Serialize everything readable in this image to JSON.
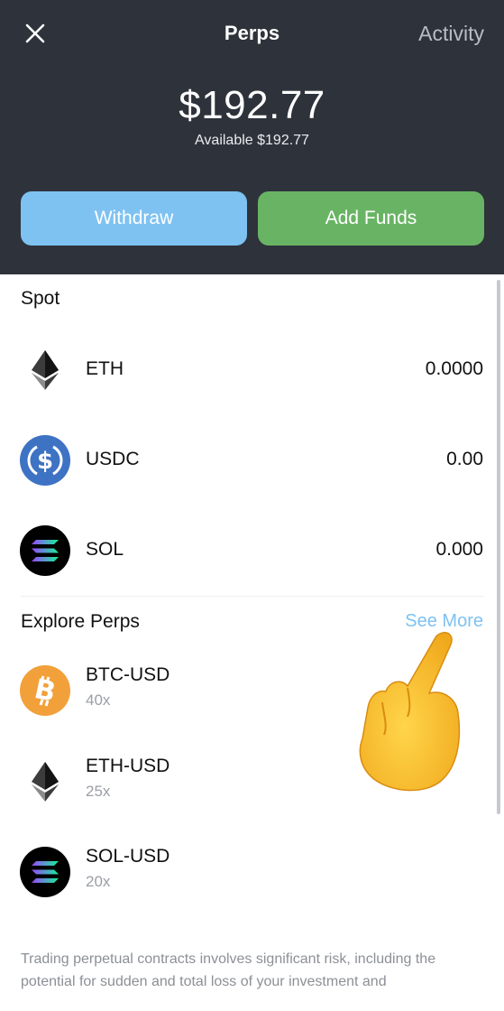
{
  "header": {
    "title": "Perps",
    "activity_label": "Activity",
    "balance": "$192.77",
    "available": "Available $192.77",
    "withdraw_label": "Withdraw",
    "add_funds_label": "Add Funds",
    "icons": {
      "close": "close-icon"
    }
  },
  "spot": {
    "title": "Spot",
    "items": [
      {
        "symbol": "ETH",
        "value": "0.0000",
        "icon": "ethereum-icon"
      },
      {
        "symbol": "USDC",
        "value": "0.00",
        "icon": "usdc-icon"
      },
      {
        "symbol": "SOL",
        "value": "0.000",
        "icon": "solana-icon"
      }
    ]
  },
  "explore": {
    "title": "Explore Perps",
    "see_more": "See More",
    "items": [
      {
        "pair": "BTC-USD",
        "leverage": "40x",
        "icon": "bitcoin-icon"
      },
      {
        "pair": "ETH-USD",
        "leverage": "25x",
        "icon": "ethereum-icon"
      },
      {
        "pair": "SOL-USD",
        "leverage": "20x",
        "icon": "solana-icon"
      }
    ]
  },
  "disclaimer": "Trading perpetual contracts involves significant risk, including the potential for sudden and total loss of your investment and",
  "colors": {
    "header_bg": "#2e333b",
    "withdraw_bg": "#7ec2f2",
    "add_funds_bg": "#69b464",
    "link": "#7ec2f2",
    "usdc_blue": "#3e73c4",
    "bitcoin_orange": "#f2a03a"
  }
}
